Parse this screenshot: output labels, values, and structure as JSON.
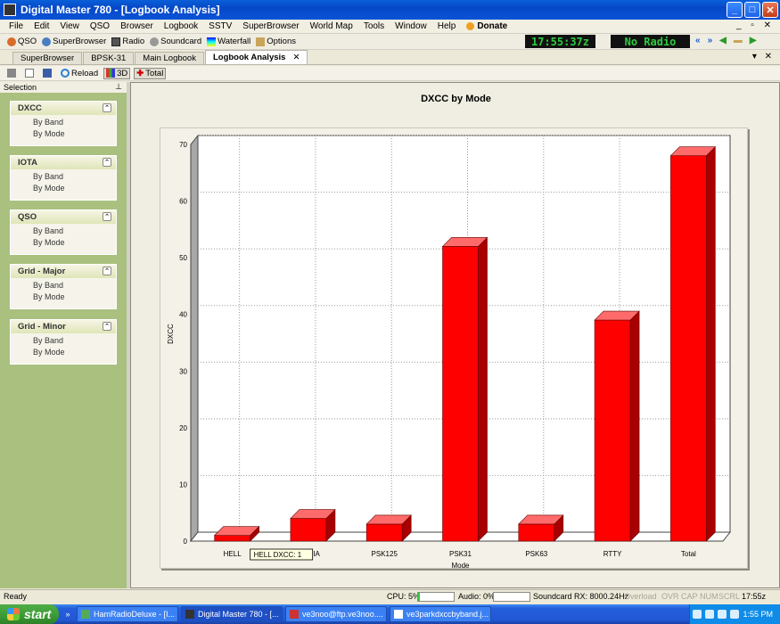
{
  "window": {
    "title": "Digital Master 780 - [Logbook Analysis]"
  },
  "menu": [
    "File",
    "Edit",
    "View",
    "QSO",
    "Browser",
    "Logbook",
    "SSTV",
    "SuperBrowser",
    "World Map",
    "Tools",
    "Window",
    "Help"
  ],
  "menu_donate": "Donate",
  "toolbar": {
    "qso": "QSO",
    "superbrowser": "SuperBrowser",
    "radio": "Radio",
    "soundcard": "Soundcard",
    "waterfall": "Waterfall",
    "options": "Options",
    "clock": "17:55:37z",
    "radio_status": "No Radio"
  },
  "doc_tabs": [
    "SuperBrowser",
    "BPSK-31",
    "Main Logbook",
    "Logbook Analysis"
  ],
  "subtoolbar": {
    "reload": "Reload",
    "three_d": "3D",
    "total": "Total"
  },
  "sidebar": {
    "header": "Selection",
    "panels": [
      {
        "title": "DXCC",
        "links": [
          "By Band",
          "By Mode"
        ]
      },
      {
        "title": "IOTA",
        "links": [
          "By Band",
          "By Mode"
        ]
      },
      {
        "title": "QSO",
        "links": [
          "By Band",
          "By Mode"
        ]
      },
      {
        "title": "Grid - Major",
        "links": [
          "By Band",
          "By Mode"
        ]
      },
      {
        "title": "Grid - Minor",
        "links": [
          "By Band",
          "By Mode"
        ]
      }
    ]
  },
  "chart_data": {
    "type": "bar",
    "title": "DXCC by Mode",
    "xlabel": "Mode",
    "ylabel": "DXCC",
    "categories": [
      "HELL",
      "OLIVIA",
      "PSK125",
      "PSK31",
      "PSK63",
      "RTTY",
      "Total"
    ],
    "values": [
      1,
      4,
      3,
      52,
      3,
      39,
      68
    ],
    "ylim": [
      0,
      70
    ],
    "yticks": [
      0,
      10,
      20,
      30,
      40,
      50,
      60,
      70
    ],
    "grid": true,
    "style": "3d",
    "bar_color": "#ff0000",
    "tooltip": "HELL DXCC: 1"
  },
  "status": {
    "ready": "Ready",
    "cpu": "CPU: 5%",
    "cpu_level": 0.05,
    "audio": "Audio: 0%",
    "audio_level": 0,
    "soundcard": "Soundcard RX: 8000.24Hz",
    "overload": "Overload",
    "ovr": "OVR",
    "cap": "CAP",
    "num": "NUM",
    "scrl": "SCRL",
    "time": "17:55z"
  },
  "taskbar": {
    "start": "start",
    "tasks": [
      "HamRadioDeluxe - [I...",
      "Digital Master 780 - [...",
      "ve3noo@ftp.ve3noo....",
      "ve3parkdxccbyband.j..."
    ],
    "clock": "1:55 PM"
  }
}
